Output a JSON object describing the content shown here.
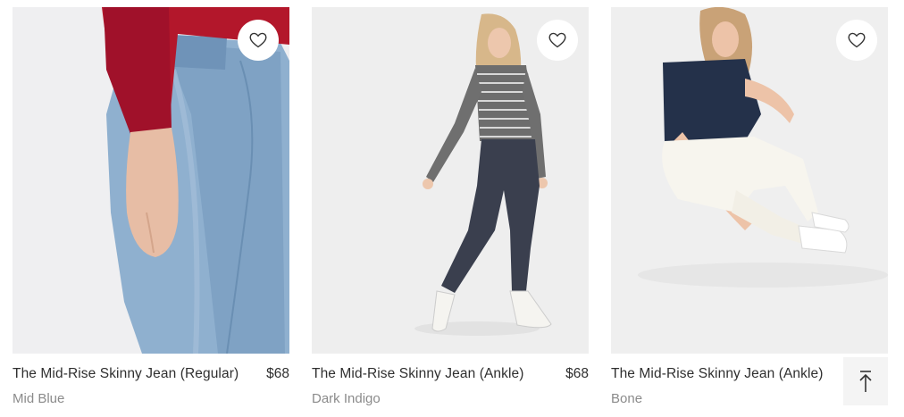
{
  "products": [
    {
      "name": "The Mid-Rise Skinny Jean (Regular)",
      "price": "$68",
      "color": "Mid Blue",
      "photo_bg": "#efeff1",
      "favorite_icon": "heart-outline-icon"
    },
    {
      "name": "The Mid-Rise Skinny Jean (Ankle)",
      "price": "$68",
      "color": "Dark Indigo",
      "photo_bg": "#eeeeee",
      "favorite_icon": "heart-outline-icon"
    },
    {
      "name": "The Mid-Rise Skinny Jean (Ankle)",
      "price": "",
      "color": "Bone",
      "photo_bg": "#efefef",
      "favorite_icon": "heart-outline-icon"
    }
  ],
  "scroll_top_icon": "arrow-up-to-top-icon"
}
